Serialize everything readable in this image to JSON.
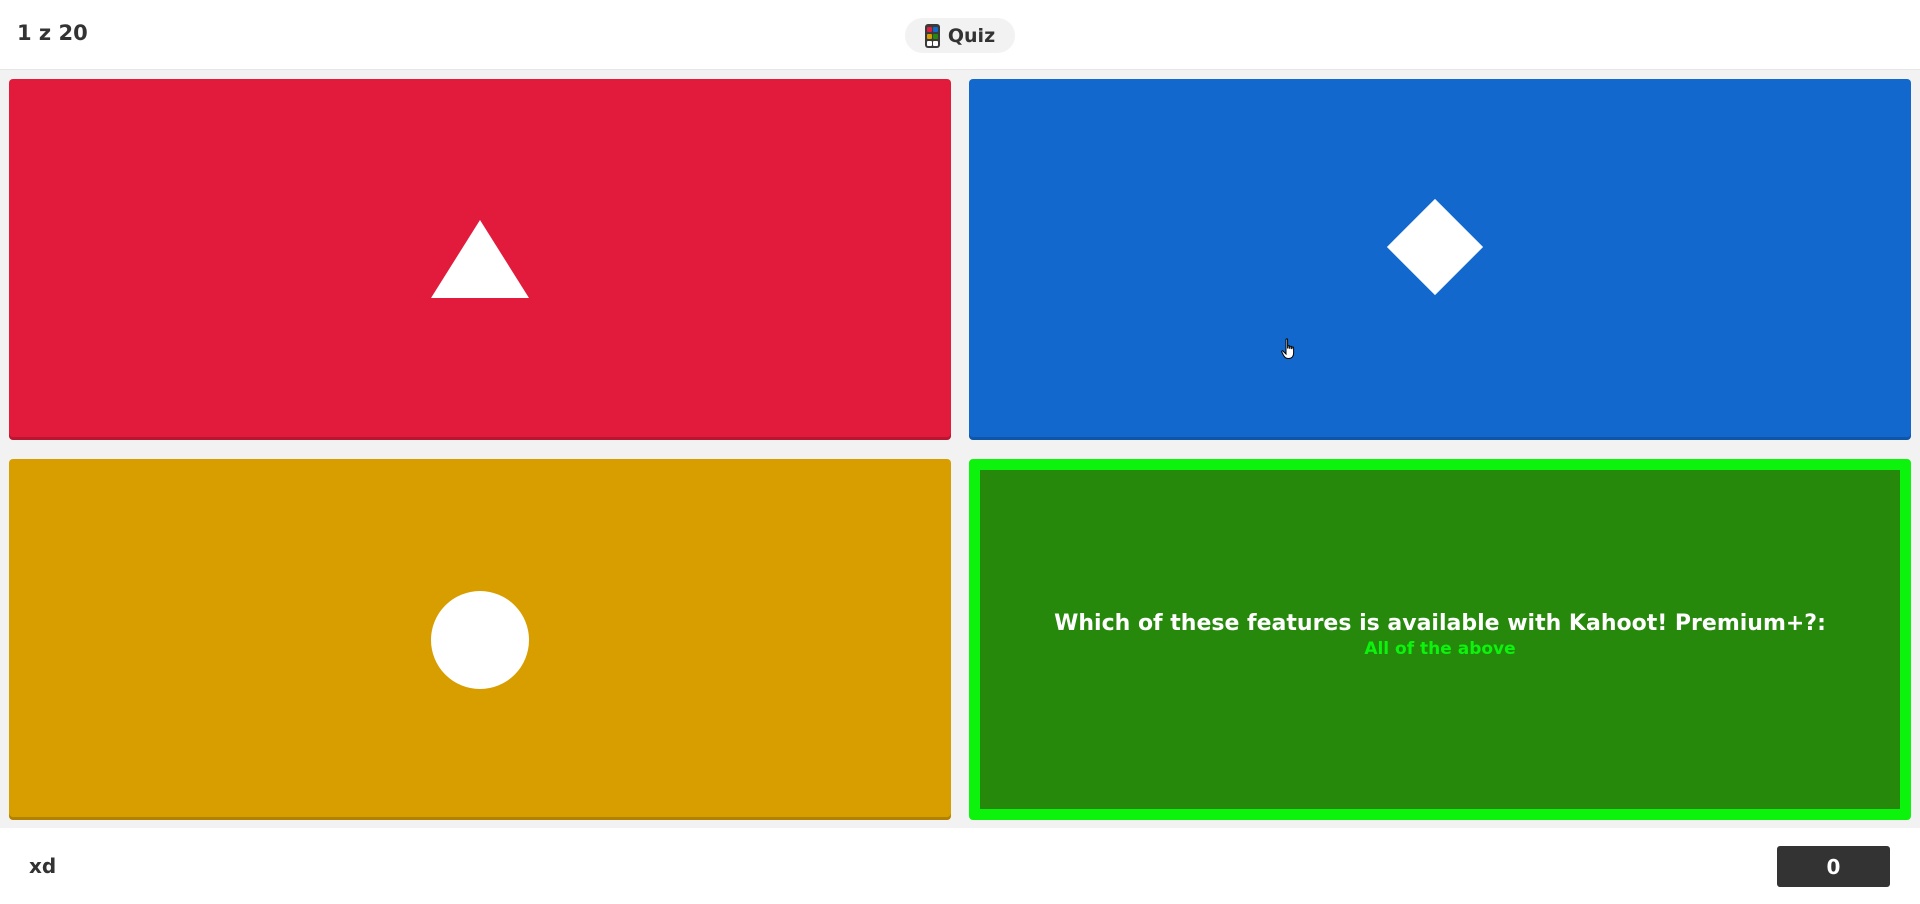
{
  "header": {
    "question_counter": "1 z 20",
    "game_type_label": "Quiz",
    "game_type_icon": "quiz-icon"
  },
  "answers": [
    {
      "color": "#e21b3c",
      "shape": "triangle-icon"
    },
    {
      "color": "#1368ce",
      "shape": "diamond-icon"
    },
    {
      "color": "#d89e00",
      "shape": "circle-icon"
    },
    {
      "color": "#26890c",
      "highlight_border": "#0cf30c",
      "question": "Which of these features is available with Kahoot! Premium+?:",
      "correct_answer": "All of the above"
    }
  ],
  "footer": {
    "player_name": "xd",
    "score": "0"
  }
}
